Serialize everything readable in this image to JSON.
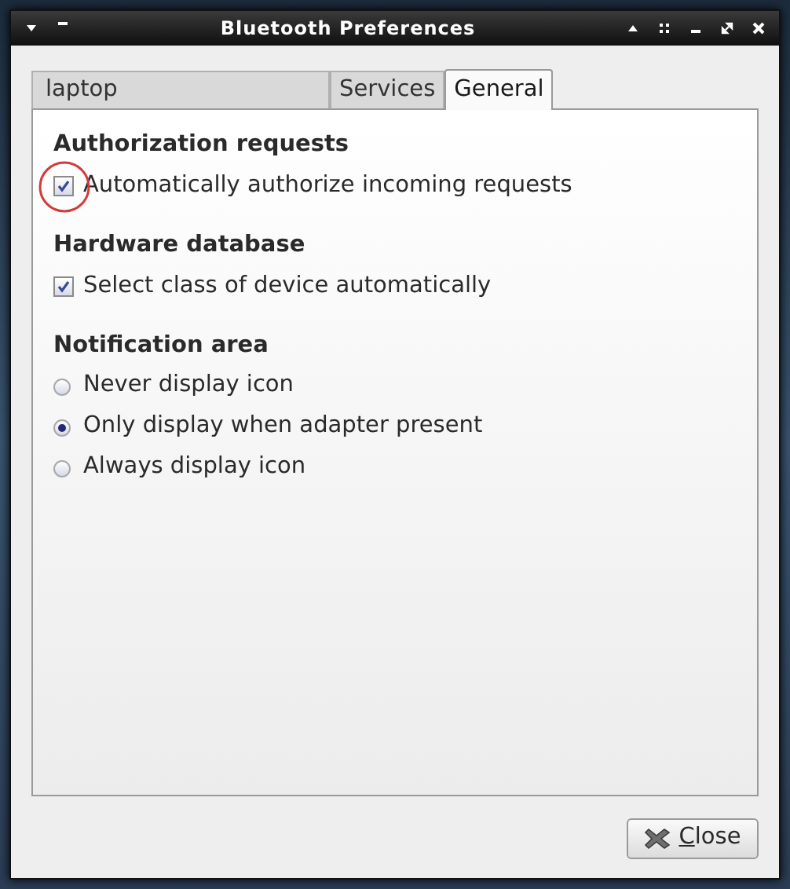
{
  "window": {
    "title": "Bluetooth Preferences"
  },
  "tabs": [
    {
      "label": "laptop",
      "selected": false
    },
    {
      "label": "Services",
      "selected": false
    },
    {
      "label": "General",
      "selected": true
    }
  ],
  "sections": [
    {
      "heading": "Authorization requests",
      "options": [
        {
          "kind": "checkbox",
          "label": "Automatically authorize incoming requests",
          "checked": true,
          "circled": true
        }
      ]
    },
    {
      "heading": "Hardware database",
      "options": [
        {
          "kind": "checkbox",
          "label": "Select class of device automatically",
          "checked": true,
          "circled": false
        }
      ]
    },
    {
      "heading": "Notification area",
      "options": [
        {
          "kind": "radio",
          "label": "Never display icon",
          "selected": false
        },
        {
          "kind": "radio",
          "label": "Only display when adapter present",
          "selected": true
        },
        {
          "kind": "radio",
          "label": "Always display icon",
          "selected": false
        }
      ]
    }
  ],
  "buttons": [
    {
      "label": "Close"
    }
  ]
}
